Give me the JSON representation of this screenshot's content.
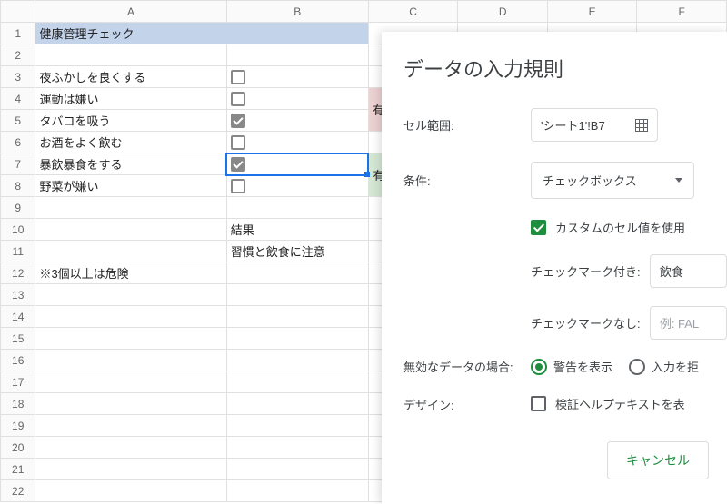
{
  "columns": [
    "A",
    "B",
    "C",
    "D",
    "E",
    "F"
  ],
  "rows": 22,
  "cells": {
    "A1": "健康管理チェック",
    "A3": "夜ふかしを良くする",
    "A4": "運動は嫌い",
    "A5": "タバコを吸う",
    "A6": "お酒をよく飲む",
    "A7": "暴飲暴食をする",
    "A8": "野菜が嫌い",
    "A12": "※3個以上は危険",
    "B10": "結果",
    "B11": "習慣と飲食に注意",
    "C4": "有効=\"習",
    "C7": "有効=\"飲"
  },
  "checkboxes": {
    "B3": false,
    "B4": false,
    "B5": true,
    "B6": false,
    "B7": true,
    "B8": false
  },
  "active_cell": "B7",
  "panel": {
    "title": "データの入力規則",
    "cell_range_label": "セル範囲:",
    "cell_range_value": "'シート1'!B7",
    "condition_label": "条件:",
    "condition_value": "チェックボックス",
    "use_custom_label": "カスタムのセル値を使用",
    "use_custom_checked": true,
    "checked_label": "チェックマーク付き:",
    "checked_value": "飲食",
    "unchecked_label": "チェックマークなし:",
    "unchecked_placeholder": "例: FAL",
    "invalid_label": "無効なデータの場合:",
    "invalid_warn": "警告を表示",
    "invalid_reject": "入力を拒",
    "design_label": "デザイン:",
    "design_help": "検証ヘルプテキストを表",
    "cancel": "キャンセル"
  }
}
